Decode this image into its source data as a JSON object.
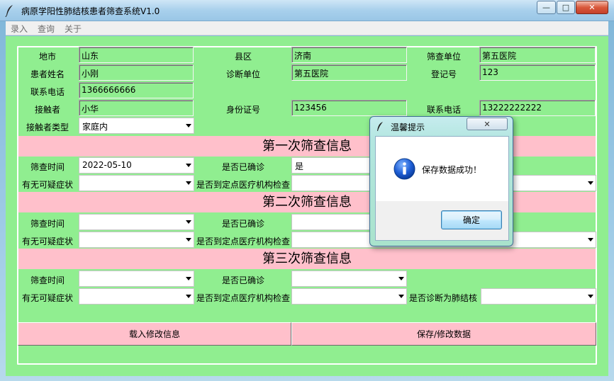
{
  "window": {
    "title": "病原学阳性肺结核患者筛查系统V1.0",
    "min_glyph": "—",
    "max_glyph": "□",
    "close_glyph": "✕"
  },
  "menu": [
    "录入",
    "查询",
    "关于"
  ],
  "form": {
    "row1": {
      "region_label": "地市",
      "region_value": "山东",
      "county_label": "县区",
      "county_value": "济南",
      "unit_label": "筛查单位",
      "unit_value": "第五医院"
    },
    "row2": {
      "name_label": "患者姓名",
      "name_value": "小刚",
      "diag_unit_label": "诊断单位",
      "diag_unit_value": "第五医院",
      "reg_label": "登记号",
      "reg_value": "123"
    },
    "row3": {
      "phone_label": "联系电话",
      "phone_value": "1366666666"
    },
    "row4": {
      "contact_label": "接触者",
      "contact_value": "小华",
      "id_label": "身份证号",
      "id_value": "123456",
      "contact_phone_label": "联系电话",
      "contact_phone_value": "13222222222"
    },
    "row5": {
      "contact_type_label": "接触者类型",
      "contact_type_value": "家庭内"
    }
  },
  "screen1": {
    "heading": "第一次筛查信息",
    "time_label": "筛查时间",
    "time_value": "2022-05-10",
    "confirmed_label": "是否已确诊",
    "confirmed_value": "是",
    "symptom_label": "有无可疑症状",
    "symptom_value": "",
    "hospital_label": "是否到定点医疗机构检查",
    "hospital_value": ""
  },
  "screen2": {
    "heading": "第二次筛查信息",
    "time_label": "筛查时间",
    "time_value": "",
    "confirmed_label": "是否已确诊",
    "confirmed_value": "",
    "symptom_label": "有无可疑症状",
    "symptom_value": "",
    "hospital_label": "是否到定点医疗机构检查",
    "hospital_value": ""
  },
  "screen3": {
    "heading": "第三次筛查信息",
    "time_label": "筛查时间",
    "time_value": "",
    "confirmed_label": "是否已确诊",
    "confirmed_value": "",
    "symptom_label": "有无可疑症状",
    "symptom_value": "",
    "hospital_label": "是否到定点医疗机构检查",
    "hospital_value": "",
    "tb_label": "是否诊断为肺结核",
    "tb_value": ""
  },
  "buttons": {
    "load": "载入修改信息",
    "save": "保存/修改数据"
  },
  "dialog": {
    "title": "温馨提示",
    "close_glyph": "✕",
    "message": "保存数据成功！",
    "ok": "确定"
  },
  "colors": {
    "panel": "#90ee90",
    "band": "#ffc0cb",
    "button": "#ffc0cb"
  }
}
